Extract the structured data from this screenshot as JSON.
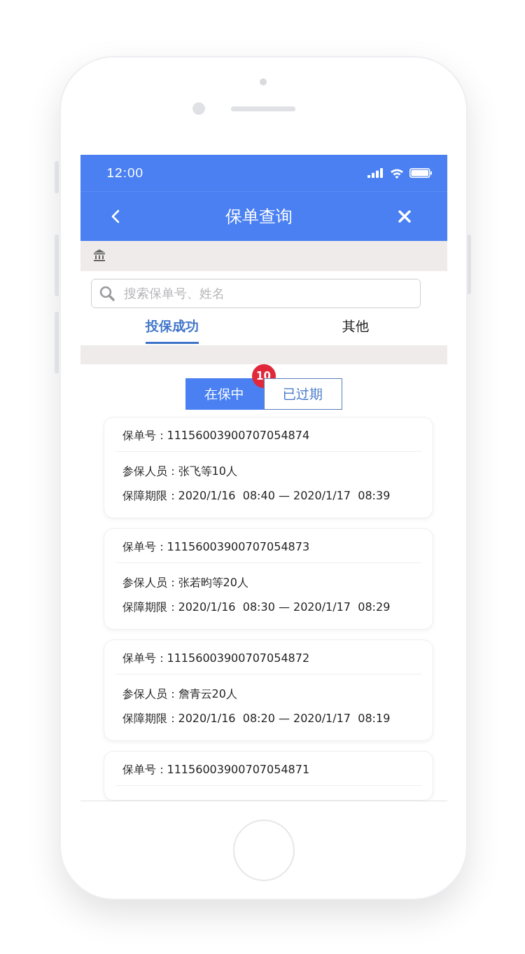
{
  "status_bar": {
    "time": "12:00"
  },
  "nav": {
    "title": "保单查询"
  },
  "search": {
    "placeholder": "搜索保单号、姓名"
  },
  "tabs": [
    {
      "label": "投保成功",
      "selected": true
    },
    {
      "label": "其他",
      "selected": false
    }
  ],
  "segments": [
    {
      "label": "在保中",
      "selected": true,
      "badge": "10"
    },
    {
      "label": "已过期",
      "selected": false
    }
  ],
  "policies": [
    {
      "number": "保单号：11156003900707054874",
      "insured": "参保人员：张飞等10人",
      "period": "保障期限：2020/1/16  08:40 — 2020/1/17  08:39"
    },
    {
      "number": "保单号：11156003900707054873",
      "insured": "参保人员：张若昀等20人",
      "period": "保障期限：2020/1/16  08:30 — 2020/1/17  08:29"
    },
    {
      "number": "保单号：11156003900707054872",
      "insured": "参保人员：詹青云20人",
      "period": "保障期限：2020/1/16  08:20 — 2020/1/17  08:19"
    },
    {
      "number": "保单号：11156003900707054871"
    }
  ]
}
